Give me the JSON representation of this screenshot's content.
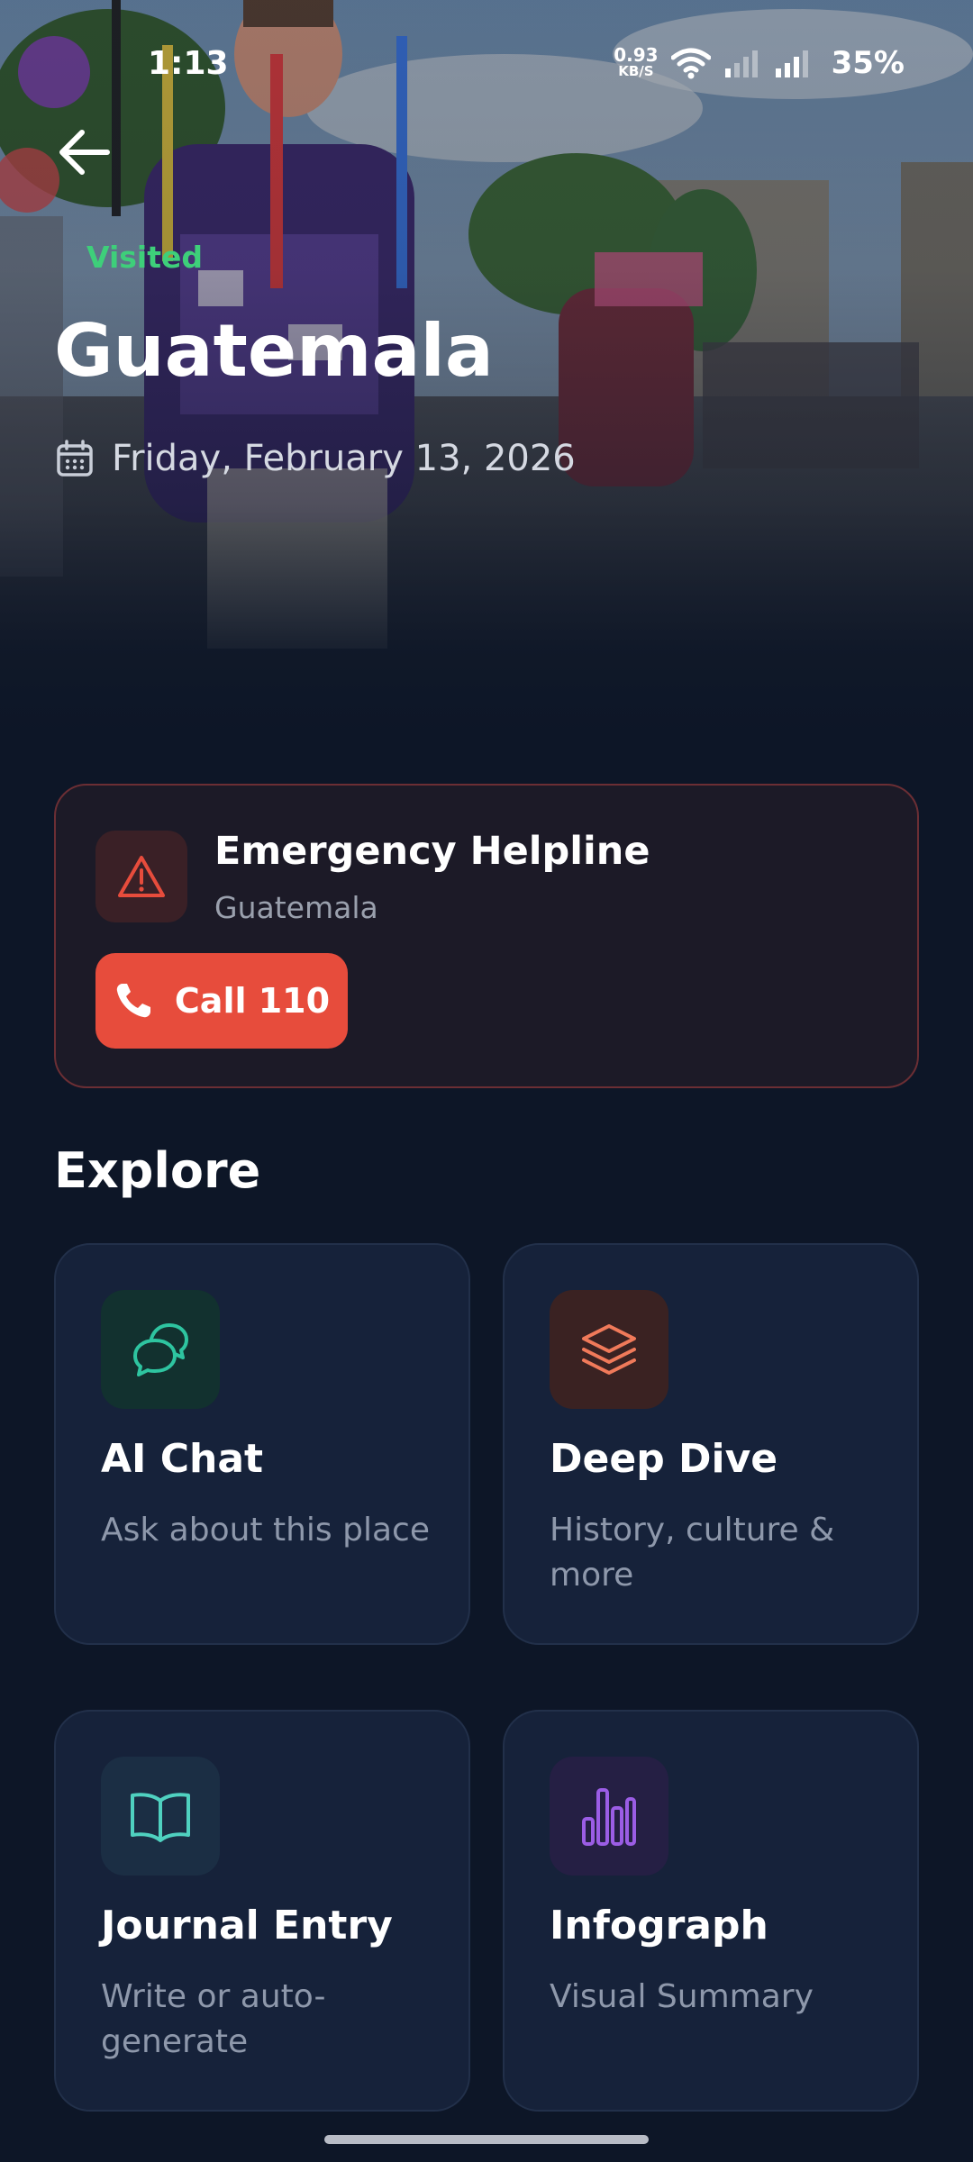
{
  "status_bar": {
    "time": "1:13",
    "net_speed_value": "0.93",
    "net_speed_unit": "KB/S",
    "battery": "35%"
  },
  "header": {
    "badge": "Visited",
    "title": "Guatemala",
    "date": "Friday, February 13, 2026"
  },
  "emergency": {
    "title": "Emergency Helpline",
    "country": "Guatemala",
    "call_label": "Call 110"
  },
  "explore": {
    "heading": "Explore",
    "tiles": [
      {
        "title": "AI Chat",
        "subtitle": "Ask about this place",
        "icon": "chat-bubbles-icon",
        "accent": "#2ec4a0",
        "icon_bg": "#12312f"
      },
      {
        "title": "Deep Dive",
        "subtitle": "History, culture & more",
        "icon": "layers-icon",
        "accent": "#f07a5a",
        "icon_bg": "#3a2222"
      },
      {
        "title": "Journal Entry",
        "subtitle": "Write or auto-generate",
        "icon": "open-book-icon",
        "accent": "#4fd1c0",
        "icon_bg": "#1b2e44"
      },
      {
        "title": "Infograph",
        "subtitle": "Visual Summary",
        "icon": "bar-chart-icon",
        "accent": "#9b5de5",
        "icon_bg": "#251f44"
      }
    ]
  },
  "colors": {
    "background": "#0d1627",
    "visited_green": "#3ecf7a",
    "emergency_red": "#e74c3c",
    "card_surface": "#16223a"
  }
}
